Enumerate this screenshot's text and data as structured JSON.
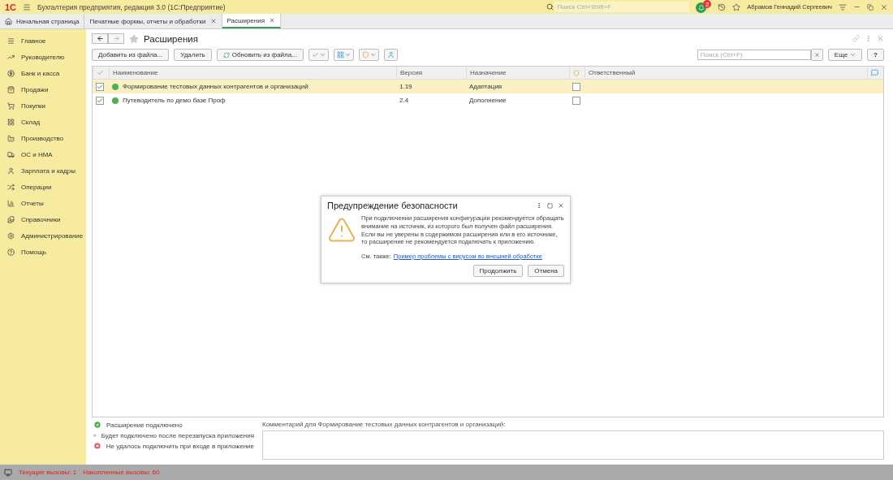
{
  "app": {
    "logo": "1С",
    "title": "Бухгалтерия предприятия, редакция 3.0  (1С:Предприятие)",
    "search_placeholder": "Поиск Ctrl+Shift+F",
    "notifications": "2",
    "user": "Абрамов Геннадий Сергеевич"
  },
  "tabs": [
    {
      "label": "Начальная страница",
      "kind": "home",
      "selected": false
    },
    {
      "label": "Печатные формы, отчеты и обработки",
      "kind": "closable",
      "selected": false
    },
    {
      "label": "Расширения",
      "kind": "closable",
      "selected": true
    }
  ],
  "sidebar": {
    "items": [
      {
        "label": "Главное"
      },
      {
        "label": "Руководителю"
      },
      {
        "label": "Банк и касса"
      },
      {
        "label": "Продажи"
      },
      {
        "label": "Покупки"
      },
      {
        "label": "Склад"
      },
      {
        "label": "Производство"
      },
      {
        "label": "ОС и НМА"
      },
      {
        "label": "Зарплата и кадры"
      },
      {
        "label": "Операции"
      },
      {
        "label": "Отчеты"
      },
      {
        "label": "Справочники"
      },
      {
        "label": "Администрирование"
      },
      {
        "label": "Помощь"
      }
    ]
  },
  "form": {
    "title": "Расширения",
    "buttons": [
      "Добавить из файла...",
      "Удалить",
      "Обновить из файла..."
    ],
    "search_placeholder": "Поиск (Ctrl+F)",
    "more": "Еще",
    "help": "?"
  },
  "table": {
    "columns": [
      "Наименование",
      "Версия",
      "Назначение",
      "Ответственный"
    ],
    "rows": [
      {
        "active": true,
        "color": "#4cb050",
        "name": "Формирование тестовых данных контрагентов и организаций",
        "version": "1.19",
        "purpose": "Адаптация",
        "safe_mode": false,
        "selected": true
      },
      {
        "active": true,
        "color": "#4cb050",
        "name": "Путеводитель по демо базе Проф",
        "version": "2.4",
        "purpose": "Дополнение",
        "safe_mode": false,
        "selected": false
      }
    ]
  },
  "legend": [
    {
      "kind": "ok",
      "text": "Расширение подключено"
    },
    {
      "kind": "pending",
      "text": "Будет подключено после перезапуска приложения"
    },
    {
      "kind": "error",
      "text": "Не удалось подключить при входе в приложение"
    }
  ],
  "comment": {
    "label": "Комментарий для Формирование тестовых данных контрагентов и организаций:"
  },
  "dialog": {
    "title": "Предупреждение безопасности",
    "text": "При подключении расширения конфигурации рекомендуется обращать внимание на источник, из которого был получен файл расширения. Если вы не уверены в содержимом расширения или в его источнике, то расширение не рекомендуется подключать к приложению.",
    "see_also": "См. также:",
    "link": "Пример проблемы с вирусом во внешней обработке",
    "buttons": [
      "Продолжить",
      "Отмена"
    ]
  },
  "status_bar": {
    "current": "Текущие вызовы: 1",
    "accumulated": "Накопленные вызовы: 60"
  }
}
